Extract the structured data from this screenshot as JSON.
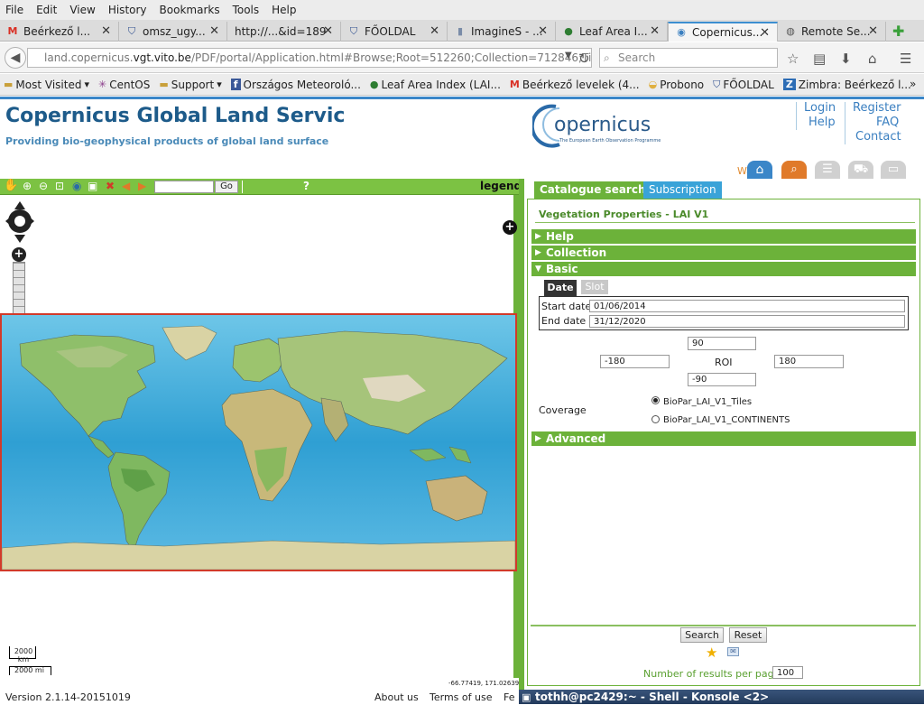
{
  "menu": [
    "File",
    "Edit",
    "View",
    "History",
    "Bookmarks",
    "Tools",
    "Help"
  ],
  "tabs": [
    {
      "title": "Beérkező l...",
      "icon": "gmail-icon"
    },
    {
      "title": "omsz_ugy...",
      "icon": "shield-icon"
    },
    {
      "title": "http://...&id=189",
      "icon": "none"
    },
    {
      "title": "FŐOLDAL",
      "icon": "shield-icon"
    },
    {
      "title": "ImagineS - ...",
      "icon": "page-icon"
    },
    {
      "title": "Leaf Area I...",
      "icon": "globe-icon"
    },
    {
      "title": "Copernicus...",
      "icon": "copernicus-icon"
    },
    {
      "title": "Remote Se...",
      "icon": "remote-icon"
    }
  ],
  "url": {
    "prefix": "land.copernicus.",
    "domain": "vgt.vito.be",
    "rest": "/PDF/portal/Application.html#Browse;Root=512260;Collection=712846;Time=NC"
  },
  "search": {
    "placeholder": "Search"
  },
  "bookmarks": [
    "Most Visited",
    "CentOS",
    "Support",
    "Országos Meteoroló...",
    "Leaf Area Index (LAI...",
    "Beérkező levelek (4...",
    "Probono",
    "FŐOLDAL",
    "Zimbra: Beérkező l..."
  ],
  "header": {
    "title": "Copernicus Global Land Servic",
    "subtitle": "Providing bio-geophysical products of global land surface"
  },
  "logo": {
    "text": "opernicus",
    "tagline": "The European Earth Observation Programme"
  },
  "links": {
    "login": "Login",
    "register": "Register",
    "help": "Help",
    "faq": "FAQ",
    "contact": "Contact"
  },
  "welcome_partial": "Wa",
  "map": {
    "go_label": "Go",
    "help_label": "?",
    "legend_label": "legend",
    "scale_km": "2000 km",
    "scale_mi": "2000 mi",
    "coords": "-66.77419, 171.02639"
  },
  "panel": {
    "tab_catalogue": "Catalogue search",
    "tab_subscription": "Subscription",
    "title": "Vegetation Properties - LAI V1",
    "sections": {
      "help": "Help",
      "collection": "Collection",
      "basic": "Basic",
      "advanced": "Advanced"
    },
    "date_tab": "Date",
    "slot_tab": "Slot",
    "start_label": "Start date",
    "start_value": "01/06/2014",
    "end_label": "End date",
    "end_value": "31/12/2020",
    "roi": {
      "label": "ROI",
      "north": "90",
      "west": "-180",
      "east": "180",
      "south": "-90"
    },
    "coverage_label": "Coverage",
    "coverage_options": [
      "BioPar_LAI_V1_Tiles",
      "BioPar_LAI_V1_CONTINENTS"
    ],
    "search_btn": "Search",
    "reset_btn": "Reset",
    "results_label": "Number of results per page",
    "results_value": "100"
  },
  "footer": {
    "version": "Version 2.1.14-20151019",
    "about": "About us",
    "terms": "Terms of use",
    "fe": "Fe"
  },
  "taskbar": {
    "title": "tothh@pc2429:~ - Shell - Konsole <2>"
  }
}
